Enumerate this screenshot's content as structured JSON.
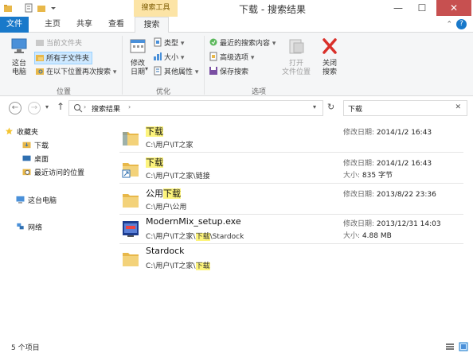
{
  "window": {
    "title": "下载 - 搜索结果",
    "context_tab_header": "搜索工具",
    "minimize": "—",
    "maximize": "☐",
    "close": "✕"
  },
  "ribbon_tabs": {
    "file": "文件",
    "home": "主页",
    "share": "共享",
    "view": "查看",
    "search": "搜索",
    "help": "?"
  },
  "ribbon": {
    "location": {
      "label": "位置",
      "this_pc": "这台\n电脑",
      "current_folder": "当前文件夹",
      "all_subfolders": "所有子文件夹",
      "search_again": "在以下位置再次搜索"
    },
    "refine": {
      "label": "优化",
      "modified_date": "修改\n日期",
      "kind": "类型",
      "size": "大小",
      "other_properties": "其他属性"
    },
    "options": {
      "label": "选项",
      "recent_searches": "最近的搜索内容",
      "advanced_options": "高级选项",
      "save_search": "保存搜索",
      "open_file_location": "打开\n文件位置",
      "close_search": "关闭\n搜索"
    }
  },
  "address_bar": {
    "breadcrumb": "搜索结果",
    "search_value": "下载",
    "clear": "✕"
  },
  "nav_pane": {
    "favorites": "收藏夹",
    "downloads": "下载",
    "desktop": "桌面",
    "recent": "最近访问的位置",
    "this_pc": "这台电脑",
    "network": "网络"
  },
  "results": {
    "modified_label": "修改日期:",
    "size_label": "大小:",
    "items": [
      {
        "name_pre": "",
        "name_hl": "下载",
        "name_post": "",
        "path_pre": "C:\\用户\\IT之家",
        "path_hl": "",
        "path_post": "",
        "modified": "2014/1/2 16:43",
        "size": ""
      },
      {
        "name_pre": "",
        "name_hl": "下载",
        "name_post": "",
        "path_pre": "C:\\用户\\IT之家\\链接",
        "path_hl": "",
        "path_post": "",
        "modified": "2014/1/2 16:43",
        "size": "835 字节"
      },
      {
        "name_pre": "公用",
        "name_hl": "下载",
        "name_post": "",
        "path_pre": "C:\\用户\\公用",
        "path_hl": "",
        "path_post": "",
        "modified": "2013/8/22 23:36",
        "size": ""
      },
      {
        "name_pre": "ModernMix_setup.exe",
        "name_hl": "",
        "name_post": "",
        "path_pre": "C:\\用户\\IT之家\\",
        "path_hl": "下载",
        "path_post": "\\Stardock",
        "modified": "2013/12/31 14:03",
        "size": "4.88 MB"
      },
      {
        "name_pre": "Stardock",
        "name_hl": "",
        "name_post": "",
        "path_pre": "C:\\用户\\IT之家\\",
        "path_hl": "下载",
        "path_post": "",
        "modified": "",
        "size": ""
      }
    ]
  },
  "status": {
    "count": "5 个项目"
  },
  "colors": {
    "accent": "#1979ca",
    "highlight": "#fdf47c",
    "context_tab": "#fce4a6"
  }
}
